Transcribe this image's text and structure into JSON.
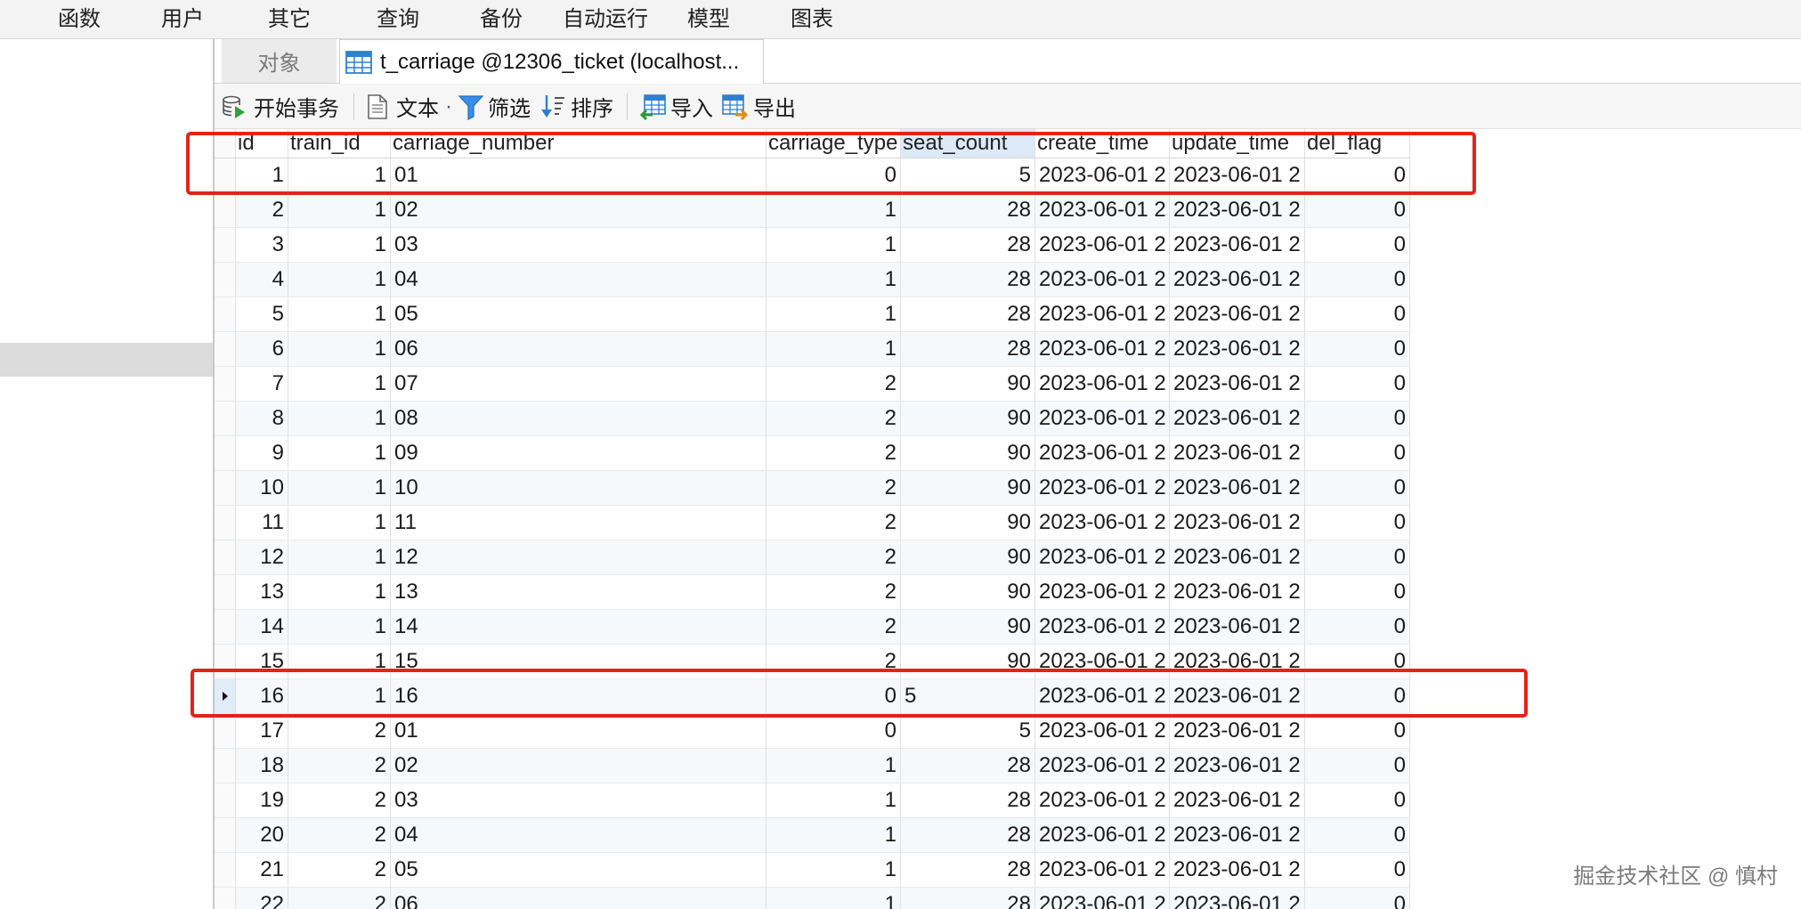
{
  "menu": {
    "items": [
      "函数",
      "用户",
      "其它",
      "查询",
      "备份",
      "自动运行",
      "模型",
      "图表"
    ]
  },
  "tabs": {
    "objects": {
      "label": "对象"
    },
    "active": {
      "label": "t_carriage @12306_ticket (localhost...",
      "icon": "table-icon"
    }
  },
  "toolbar": {
    "begin_transaction": {
      "label": "开始事务",
      "icon": "database-transaction-icon"
    },
    "text": {
      "label": "文本",
      "dropdown": "·",
      "icon": "document-text-icon"
    },
    "filter": {
      "label": "筛选",
      "icon": "filter-icon"
    },
    "sort": {
      "label": "排序",
      "icon": "sort-icon"
    },
    "import": {
      "label": "导入",
      "icon": "import-icon"
    },
    "export": {
      "label": "导出",
      "icon": "export-icon"
    }
  },
  "grid": {
    "columns": [
      {
        "label": "id"
      },
      {
        "label": "train_id"
      },
      {
        "label": "carriage_number"
      },
      {
        "label": "carriage_type"
      },
      {
        "label": "seat_count",
        "selected": true
      },
      {
        "label": "create_time"
      },
      {
        "label": "update_time"
      },
      {
        "label": "del_flag"
      }
    ],
    "rows": [
      {
        "cells": [
          "1",
          "1",
          "01",
          "0",
          "5",
          "2023-06-01 2",
          "2023-06-01 2",
          "0"
        ]
      },
      {
        "cells": [
          "2",
          "1",
          "02",
          "1",
          "28",
          "2023-06-01 2",
          "2023-06-01 2",
          "0"
        ]
      },
      {
        "cells": [
          "3",
          "1",
          "03",
          "1",
          "28",
          "2023-06-01 2",
          "2023-06-01 2",
          "0"
        ]
      },
      {
        "cells": [
          "4",
          "1",
          "04",
          "1",
          "28",
          "2023-06-01 2",
          "2023-06-01 2",
          "0"
        ]
      },
      {
        "cells": [
          "5",
          "1",
          "05",
          "1",
          "28",
          "2023-06-01 2",
          "2023-06-01 2",
          "0"
        ]
      },
      {
        "cells": [
          "6",
          "1",
          "06",
          "1",
          "28",
          "2023-06-01 2",
          "2023-06-01 2",
          "0"
        ]
      },
      {
        "cells": [
          "7",
          "1",
          "07",
          "2",
          "90",
          "2023-06-01 2",
          "2023-06-01 2",
          "0"
        ]
      },
      {
        "cells": [
          "8",
          "1",
          "08",
          "2",
          "90",
          "2023-06-01 2",
          "2023-06-01 2",
          "0"
        ]
      },
      {
        "cells": [
          "9",
          "1",
          "09",
          "2",
          "90",
          "2023-06-01 2",
          "2023-06-01 2",
          "0"
        ]
      },
      {
        "cells": [
          "10",
          "1",
          "10",
          "2",
          "90",
          "2023-06-01 2",
          "2023-06-01 2",
          "0"
        ]
      },
      {
        "cells": [
          "11",
          "1",
          "11",
          "2",
          "90",
          "2023-06-01 2",
          "2023-06-01 2",
          "0"
        ]
      },
      {
        "cells": [
          "12",
          "1",
          "12",
          "2",
          "90",
          "2023-06-01 2",
          "2023-06-01 2",
          "0"
        ]
      },
      {
        "cells": [
          "13",
          "1",
          "13",
          "2",
          "90",
          "2023-06-01 2",
          "2023-06-01 2",
          "0"
        ]
      },
      {
        "cells": [
          "14",
          "1",
          "14",
          "2",
          "90",
          "2023-06-01 2",
          "2023-06-01 2",
          "0"
        ]
      },
      {
        "cells": [
          "15",
          "1",
          "15",
          "2",
          "90",
          "2023-06-01 2",
          "2023-06-01 2",
          "0"
        ]
      },
      {
        "cells": [
          "16",
          "1",
          "16",
          "0",
          "5",
          "2023-06-01 2",
          "2023-06-01 2",
          "0"
        ],
        "current": true,
        "editing_cell": 4
      },
      {
        "cells": [
          "17",
          "2",
          "01",
          "0",
          "5",
          "2023-06-01 2",
          "2023-06-01 2",
          "0"
        ]
      },
      {
        "cells": [
          "18",
          "2",
          "02",
          "1",
          "28",
          "2023-06-01 2",
          "2023-06-01 2",
          "0"
        ]
      },
      {
        "cells": [
          "19",
          "2",
          "03",
          "1",
          "28",
          "2023-06-01 2",
          "2023-06-01 2",
          "0"
        ]
      },
      {
        "cells": [
          "20",
          "2",
          "04",
          "1",
          "28",
          "2023-06-01 2",
          "2023-06-01 2",
          "0"
        ]
      },
      {
        "cells": [
          "21",
          "2",
          "05",
          "1",
          "28",
          "2023-06-01 2",
          "2023-06-01 2",
          "0"
        ]
      },
      {
        "cells": [
          "22",
          "2",
          "06",
          "1",
          "28",
          "2023-06-01 2",
          "2023-06-01 2",
          "0"
        ]
      }
    ]
  },
  "watermark": "掘金技术社区 @ 慎村",
  "colors": {
    "highlight_box": "#e3231c",
    "selected_header": "#dce9f7",
    "row_alt": "#f6f9fc",
    "current_row_indicator": "#e1ecf8",
    "accent": "#2f7fd1"
  }
}
